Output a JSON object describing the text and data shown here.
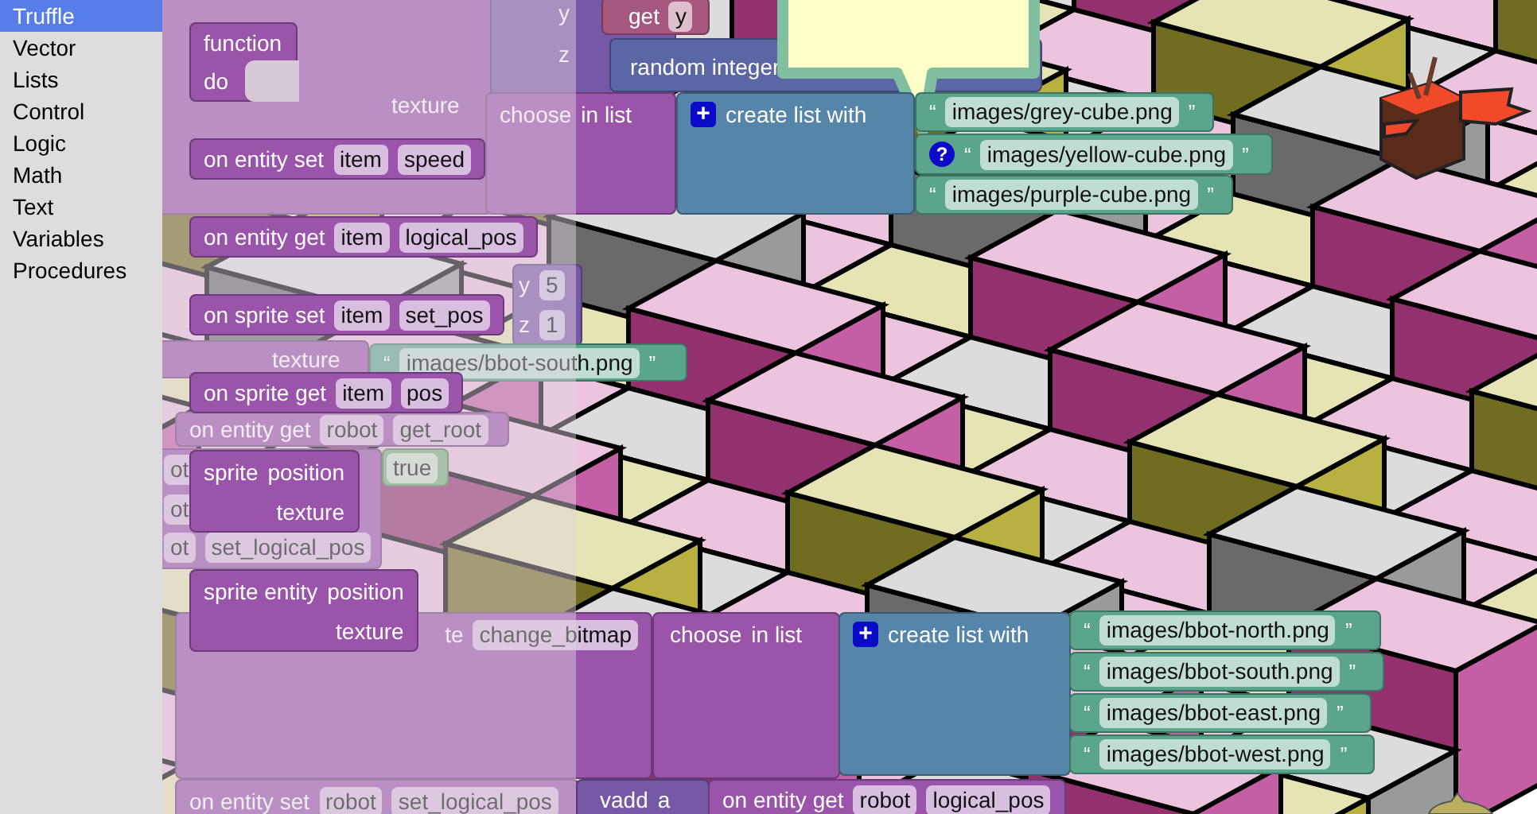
{
  "categories": [
    {
      "label": "Truffle",
      "selected": true
    },
    {
      "label": "Vector",
      "selected": false
    },
    {
      "label": "Lists",
      "selected": false
    },
    {
      "label": "Control",
      "selected": false
    },
    {
      "label": "Logic",
      "selected": false
    },
    {
      "label": "Math",
      "selected": false
    },
    {
      "label": "Text",
      "selected": false
    },
    {
      "label": "Variables",
      "selected": false
    },
    {
      "label": "Procedures",
      "selected": false
    }
  ],
  "flyout": {
    "blocks": [
      {
        "kind": "procedure",
        "label": "function",
        "statement": "do"
      },
      {
        "kind": "event",
        "label": "on entity set",
        "fields": [
          "item",
          "speed"
        ]
      },
      {
        "kind": "event",
        "label": "on entity get",
        "fields": [
          "item",
          "logical_pos"
        ]
      },
      {
        "kind": "event",
        "label": "on sprite set",
        "fields": [
          "item",
          "set_pos"
        ]
      },
      {
        "kind": "event",
        "label": "on sprite get",
        "fields": [
          "item",
          "pos"
        ]
      },
      {
        "kind": "constructor",
        "label": "sprite",
        "inputs": [
          "position",
          "texture"
        ]
      },
      {
        "kind": "constructor",
        "label": "sprite entity",
        "inputs": [
          "position",
          "texture"
        ]
      }
    ]
  },
  "workspace": {
    "blocks": [
      {
        "kind": "truffle",
        "rows": [
          [
            {
              "kind": "label",
              "text": "texture"
            }
          ]
        ]
      },
      {
        "kind": "vector",
        "rows": [
          [
            {
              "kind": "label",
              "text": "y"
            }
          ],
          [
            {
              "kind": "label",
              "text": "z"
            }
          ]
        ]
      },
      {
        "kind": "variable",
        "rows": [
          [
            {
              "kind": "label",
              "text": "get"
            },
            {
              "kind": "field",
              "text": "y"
            }
          ]
        ]
      },
      {
        "kind": "math",
        "rows": [
          [
            {
              "kind": "label",
              "text": "random integer"
            }
          ]
        ]
      },
      {
        "kind": "truffle",
        "rows": [
          [
            {
              "kind": "label",
              "text": "choose"
            },
            {
              "kind": "label",
              "text": "in list"
            }
          ]
        ]
      },
      {
        "kind": "list",
        "rows": [
          [
            {
              "kind": "plus",
              "text": "+"
            },
            {
              "kind": "label",
              "text": "create list with"
            }
          ]
        ]
      },
      {
        "kind": "text",
        "rows": [
          [
            {
              "kind": "quote",
              "text": "“"
            },
            {
              "kind": "field",
              "text": "images/grey-cube.png"
            },
            {
              "kind": "quote",
              "text": "”"
            }
          ]
        ]
      },
      {
        "kind": "text",
        "rows": [
          [
            {
              "kind": "help",
              "text": "?"
            },
            {
              "kind": "quote",
              "text": "“"
            },
            {
              "kind": "field",
              "text": "images/yellow-cube.png"
            },
            {
              "kind": "quote",
              "text": "”"
            }
          ]
        ]
      },
      {
        "kind": "text",
        "rows": [
          [
            {
              "kind": "quote",
              "text": "“"
            },
            {
              "kind": "field",
              "text": "images/purple-cube.png"
            },
            {
              "kind": "quote",
              "text": "”"
            }
          ]
        ]
      },
      {
        "kind": "vector",
        "rows": [
          [
            {
              "kind": "label",
              "text": "y"
            },
            {
              "kind": "field",
              "text": "5"
            }
          ],
          [
            {
              "kind": "label",
              "text": "z"
            },
            {
              "kind": "field",
              "text": "1"
            }
          ]
        ]
      },
      {
        "kind": "truffle",
        "rows": [
          [
            {
              "kind": "label",
              "text": "texture"
            }
          ]
        ]
      },
      {
        "kind": "text",
        "rows": [
          [
            {
              "kind": "quote",
              "text": "“"
            },
            {
              "kind": "field",
              "text": "images/bbot-south.png"
            },
            {
              "kind": "quote",
              "text": "”"
            }
          ]
        ]
      },
      {
        "kind": "truffle",
        "rows": [
          [
            {
              "kind": "label",
              "text": "on entity get"
            },
            {
              "kind": "field",
              "text": "robot"
            },
            {
              "kind": "field",
              "text": "get_root"
            }
          ]
        ]
      },
      {
        "kind": "truffle",
        "rows": [
          [
            {
              "kind": "field",
              "text": "ot"
            }
          ],
          [
            {
              "kind": "field",
              "text": "ot"
            }
          ],
          [
            {
              "kind": "field",
              "text": "ot"
            },
            {
              "kind": "field",
              "text": "set_logical_pos"
            }
          ]
        ]
      },
      {
        "kind": "logic",
        "rows": [
          [
            {
              "kind": "field",
              "text": "true"
            }
          ]
        ]
      },
      {
        "kind": "truffle",
        "rows": [
          [
            {
              "kind": "label",
              "text": "te"
            },
            {
              "kind": "field",
              "text": "change_bitmap"
            }
          ]
        ]
      },
      {
        "kind": "truffle",
        "rows": [
          [
            {
              "kind": "label",
              "text": "choose"
            },
            {
              "kind": "label",
              "text": "in list"
            }
          ]
        ]
      },
      {
        "kind": "list",
        "rows": [
          [
            {
              "kind": "plus",
              "text": "+"
            },
            {
              "kind": "label",
              "text": "create list with"
            }
          ]
        ]
      },
      {
        "kind": "text",
        "rows": [
          [
            {
              "kind": "quote",
              "text": "“"
            },
            {
              "kind": "field",
              "text": "images/bbot-north.png"
            },
            {
              "kind": "quote",
              "text": "”"
            }
          ]
        ]
      },
      {
        "kind": "text",
        "rows": [
          [
            {
              "kind": "quote",
              "text": "“"
            },
            {
              "kind": "field",
              "text": "images/bbot-south.png"
            },
            {
              "kind": "quote",
              "text": "”"
            }
          ]
        ]
      },
      {
        "kind": "text",
        "rows": [
          [
            {
              "kind": "quote",
              "text": "“"
            },
            {
              "kind": "field",
              "text": "images/bbot-east.png"
            },
            {
              "kind": "quote",
              "text": "”"
            }
          ]
        ]
      },
      {
        "kind": "text",
        "rows": [
          [
            {
              "kind": "quote",
              "text": "“"
            },
            {
              "kind": "field",
              "text": "images/bbot-west.png"
            },
            {
              "kind": "quote",
              "text": "”"
            }
          ]
        ]
      },
      {
        "kind": "truffle",
        "rows": [
          [
            {
              "kind": "label",
              "text": "on entity set"
            },
            {
              "kind": "field",
              "text": "robot"
            },
            {
              "kind": "field",
              "text": "set_logical_pos"
            }
          ]
        ]
      },
      {
        "kind": "vector",
        "rows": [
          [
            {
              "kind": "label",
              "text": "vadd"
            },
            {
              "kind": "label",
              "text": "a"
            }
          ]
        ]
      },
      {
        "kind": "truffle",
        "rows": [
          [
            {
              "kind": "label",
              "text": "on entity get"
            },
            {
              "kind": "field",
              "text": "robot"
            },
            {
              "kind": "field",
              "text": "logical_pos"
            }
          ]
        ]
      }
    ]
  }
}
